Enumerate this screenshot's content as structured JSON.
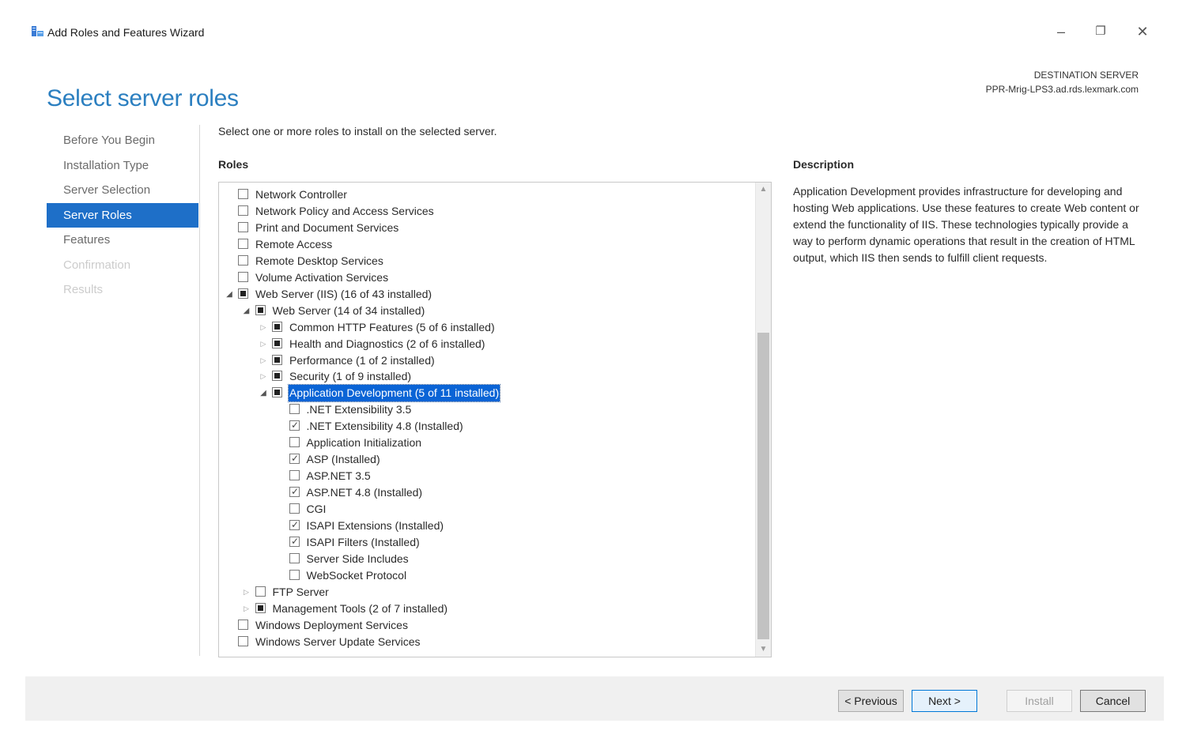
{
  "window": {
    "title": "Add Roles and Features Wizard",
    "controls": {
      "minimize": "–",
      "restore": "❐",
      "close": "✕"
    }
  },
  "page": {
    "heading": "Select server roles",
    "destination_label": "DESTINATION SERVER",
    "destination_server": "PPR-Mrig-LPS3.ad.rds.lexmark.com",
    "instruction": "Select one or more roles to install on the selected server.",
    "roles_label": "Roles",
    "description_label": "Description",
    "description_text": "Application Development provides infrastructure for developing and hosting Web applications. Use these features to create Web content or extend the functionality of IIS. These technologies typically provide a way to perform dynamic operations that result in the creation of HTML output, which IIS then sends to fulfill client requests."
  },
  "nav": {
    "items": [
      {
        "label": "Before You Begin",
        "state": "normal"
      },
      {
        "label": "Installation Type",
        "state": "normal"
      },
      {
        "label": "Server Selection",
        "state": "normal"
      },
      {
        "label": "Server Roles",
        "state": "active"
      },
      {
        "label": "Features",
        "state": "normal"
      },
      {
        "label": "Confirmation",
        "state": "disabled"
      },
      {
        "label": "Results",
        "state": "disabled"
      }
    ]
  },
  "roles": [
    {
      "label": "Network Controller",
      "level": 0,
      "expander": "none",
      "check": "unchecked"
    },
    {
      "label": "Network Policy and Access Services",
      "level": 0,
      "expander": "none",
      "check": "unchecked"
    },
    {
      "label": "Print and Document Services",
      "level": 0,
      "expander": "none",
      "check": "unchecked"
    },
    {
      "label": "Remote Access",
      "level": 0,
      "expander": "none",
      "check": "unchecked"
    },
    {
      "label": "Remote Desktop Services",
      "level": 0,
      "expander": "none",
      "check": "unchecked"
    },
    {
      "label": "Volume Activation Services",
      "level": 0,
      "expander": "none",
      "check": "unchecked"
    },
    {
      "label": "Web Server (IIS) (16 of 43 installed)",
      "level": 0,
      "expander": "expanded",
      "check": "partial"
    },
    {
      "label": "Web Server (14 of 34 installed)",
      "level": 1,
      "expander": "expanded",
      "check": "partial"
    },
    {
      "label": "Common HTTP Features (5 of 6 installed)",
      "level": 2,
      "expander": "collapsed",
      "check": "partial"
    },
    {
      "label": "Health and Diagnostics (2 of 6 installed)",
      "level": 2,
      "expander": "collapsed",
      "check": "partial"
    },
    {
      "label": "Performance (1 of 2 installed)",
      "level": 2,
      "expander": "collapsed",
      "check": "partial"
    },
    {
      "label": "Security (1 of 9 installed)",
      "level": 2,
      "expander": "collapsed",
      "check": "partial"
    },
    {
      "label": "Application Development (5 of 11 installed)",
      "level": 2,
      "expander": "expanded",
      "check": "partial",
      "selected": true
    },
    {
      "label": ".NET Extensibility 3.5",
      "level": 3,
      "expander": "none",
      "check": "unchecked"
    },
    {
      "label": ".NET Extensibility 4.8 (Installed)",
      "level": 3,
      "expander": "none",
      "check": "checked"
    },
    {
      "label": "Application Initialization",
      "level": 3,
      "expander": "none",
      "check": "unchecked"
    },
    {
      "label": "ASP (Installed)",
      "level": 3,
      "expander": "none",
      "check": "checked"
    },
    {
      "label": "ASP.NET 3.5",
      "level": 3,
      "expander": "none",
      "check": "unchecked"
    },
    {
      "label": "ASP.NET 4.8 (Installed)",
      "level": 3,
      "expander": "none",
      "check": "checked"
    },
    {
      "label": "CGI",
      "level": 3,
      "expander": "none",
      "check": "unchecked"
    },
    {
      "label": "ISAPI Extensions (Installed)",
      "level": 3,
      "expander": "none",
      "check": "checked"
    },
    {
      "label": "ISAPI Filters (Installed)",
      "level": 3,
      "expander": "none",
      "check": "checked"
    },
    {
      "label": "Server Side Includes",
      "level": 3,
      "expander": "none",
      "check": "unchecked"
    },
    {
      "label": "WebSocket Protocol",
      "level": 3,
      "expander": "none",
      "check": "unchecked"
    },
    {
      "label": "FTP Server",
      "level": 1,
      "expander": "collapsed",
      "check": "unchecked"
    },
    {
      "label": "Management Tools (2 of 7 installed)",
      "level": 1,
      "expander": "collapsed",
      "check": "partial"
    },
    {
      "label": "Windows Deployment Services",
      "level": 0,
      "expander": "none",
      "check": "unchecked"
    },
    {
      "label": "Windows Server Update Services",
      "level": 0,
      "expander": "none",
      "check": "unchecked"
    }
  ],
  "buttons": {
    "previous": "< Previous",
    "next": "Next >",
    "install": "Install",
    "cancel": "Cancel"
  },
  "colors": {
    "accent": "#1e6fc8",
    "heading": "#2b7fc0",
    "selection": "#0a64d6"
  }
}
